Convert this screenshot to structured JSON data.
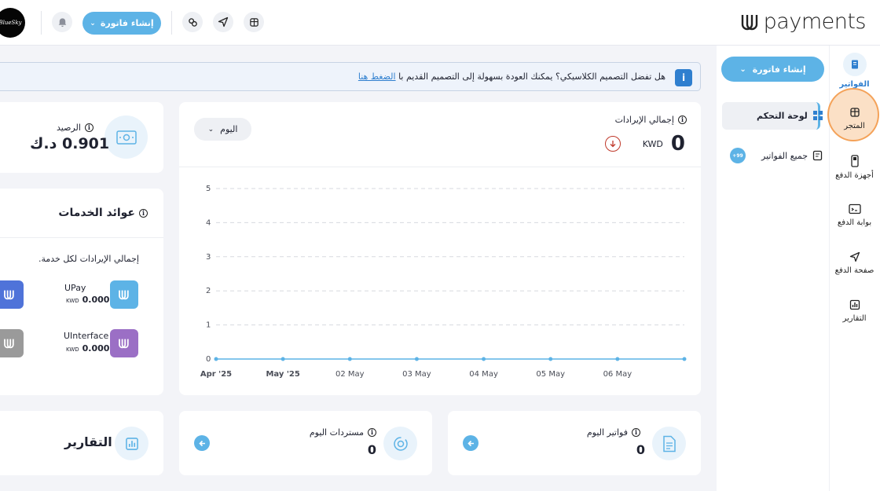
{
  "brand": {
    "logo_text": "payments",
    "avatar_text": "BlueSky"
  },
  "topbar": {
    "create_invoice_label": "إنشاء فاتورة"
  },
  "rail": {
    "items": [
      {
        "label": "الفواتير",
        "icon": "invoice-icon"
      },
      {
        "label": "المتجر",
        "icon": "store-icon"
      },
      {
        "label": "أجهزة الدفع",
        "icon": "pos-device-icon"
      },
      {
        "label": "بوابة الدفع",
        "icon": "gateway-icon"
      },
      {
        "label": "صفحة الدفع",
        "icon": "send-icon"
      },
      {
        "label": "التقارير",
        "icon": "report-icon"
      }
    ]
  },
  "subnav": {
    "create_invoice_label": "إنشاء فاتورة",
    "items": [
      {
        "label": "لوحة التحكم",
        "icon": "dashboard-icon"
      },
      {
        "label": "جميع الفواتير",
        "icon": "invoices-list-icon",
        "badge": "+99"
      }
    ]
  },
  "banner": {
    "text": "هل تفضل التصميم الكلاسيكي؟ يمكنك العودة بسهولة إلى التصميم القديم با",
    "link": "الضغط هنا"
  },
  "revenue_card": {
    "title": "إجمالي الإيرادات",
    "value": "0",
    "currency": "KWD",
    "period": "اليوم"
  },
  "balance_card": {
    "title": "الرصيد",
    "value": "0.901 د.ك"
  },
  "services_card": {
    "title": "عوائد الخدمات",
    "subtitle": "إجمالي الإيرادات لكل خدمة.",
    "services": [
      {
        "name": "UPay",
        "amount": "0.000",
        "currency": "KWD",
        "color": "#5db3e6"
      },
      {
        "name": "UInterface",
        "amount": "0.000",
        "currency": "KWD",
        "color": "#9b6fc5"
      }
    ],
    "extra_tiles_colors": [
      "#4f73d9",
      "#9a9a9a"
    ]
  },
  "stats": {
    "today_invoices": {
      "title": "فواتير اليوم",
      "value": "0"
    },
    "today_refunds": {
      "title": "مستردات اليوم",
      "value": "0"
    },
    "reports": {
      "title": "التقارير"
    }
  },
  "colors": {
    "accent": "#5db3e6",
    "highlight": "#f4a259",
    "link": "#2f7fcf"
  },
  "chart_data": {
    "type": "line",
    "x": [
      "Apr '25",
      "May '25",
      "02 May",
      "03 May",
      "04 May",
      "05 May",
      "06 May",
      ""
    ],
    "x_ticks": [
      "Apr '25",
      "May '25",
      "02 May",
      "03 May",
      "04 May",
      "05 May",
      "06 May"
    ],
    "series": [
      {
        "values": [
          0,
          0,
          0,
          0,
          0,
          0,
          0,
          0
        ]
      }
    ],
    "ylim": [
      0,
      5
    ],
    "y_ticks": [
      0,
      1,
      2,
      3,
      4,
      5
    ],
    "grid": true,
    "title": "",
    "xlabel": "",
    "ylabel": ""
  }
}
